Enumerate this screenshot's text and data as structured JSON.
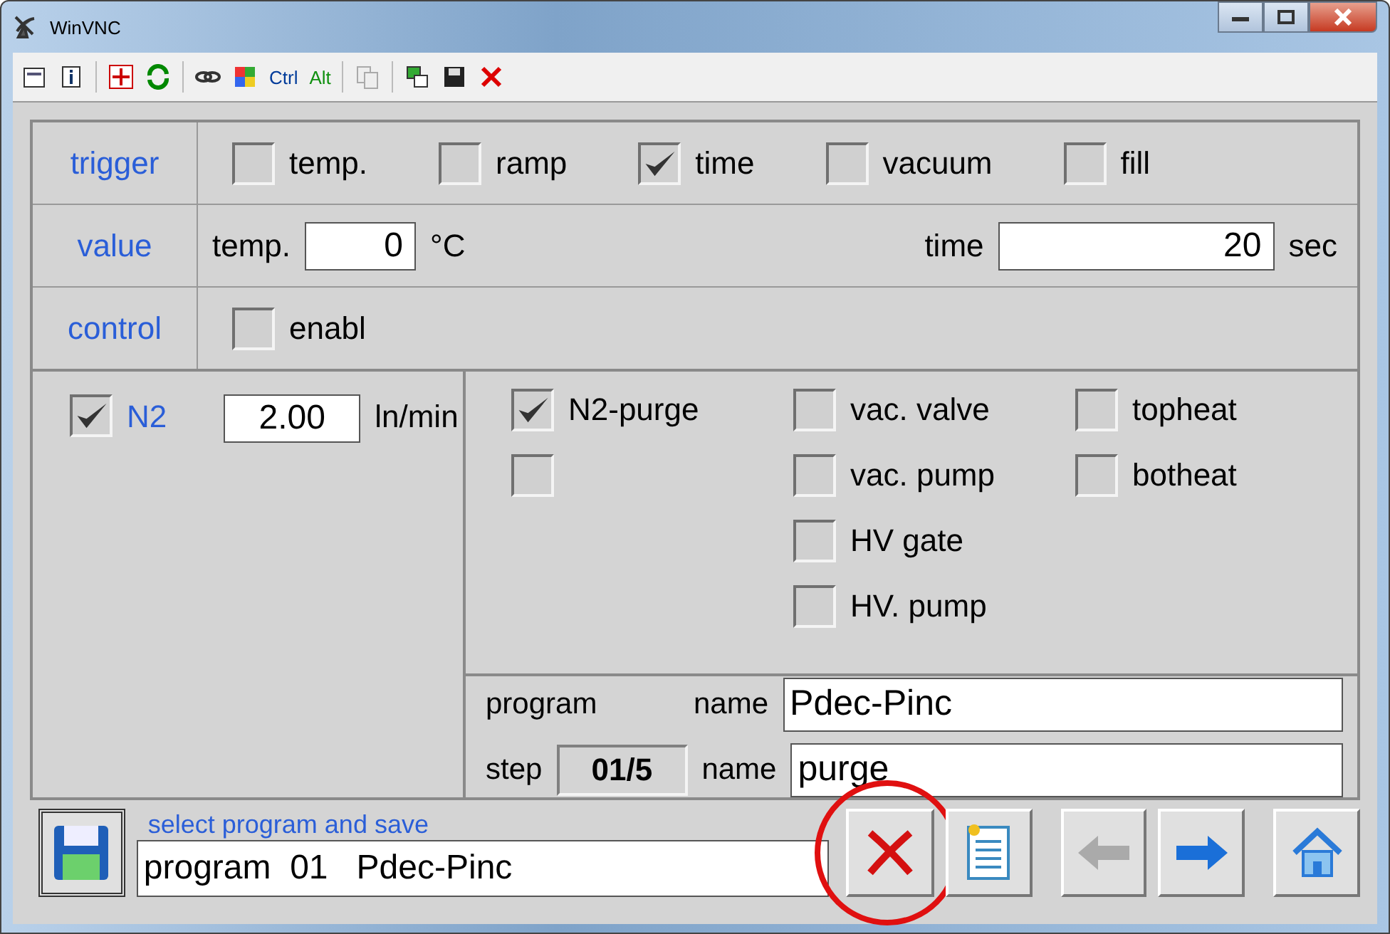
{
  "window": {
    "title": "WinVNC"
  },
  "toolbar": {
    "keys": [
      "Ctrl",
      "Alt"
    ]
  },
  "trigger": {
    "label": "trigger",
    "options": [
      {
        "label": "temp.",
        "checked": false
      },
      {
        "label": "ramp",
        "checked": false
      },
      {
        "label": "time",
        "checked": true
      },
      {
        "label": "vacuum",
        "checked": false
      },
      {
        "label": "fill",
        "checked": false
      }
    ]
  },
  "value": {
    "label": "value",
    "fields": [
      {
        "label": "temp.",
        "value": "0",
        "unit": "°C"
      },
      {
        "label": "time",
        "value": "20",
        "unit": "sec"
      }
    ]
  },
  "control": {
    "label": "control",
    "options": [
      {
        "label": "enabl",
        "checked": false
      }
    ]
  },
  "gas": {
    "label": "N2",
    "checked": true,
    "value": "2.00",
    "unit": "ln/min"
  },
  "outputs": [
    [
      {
        "label": "N2-purge",
        "checked": true
      },
      {
        "checked": false
      }
    ],
    [
      {
        "label": "vac. valve",
        "checked": false
      },
      {
        "label": "vac. pump",
        "checked": false
      },
      {
        "label": "HV gate",
        "checked": false
      },
      {
        "label": "HV. pump",
        "checked": false
      }
    ],
    [
      {
        "label": "topheat",
        "checked": false
      },
      {
        "label": "botheat",
        "checked": false
      }
    ]
  ],
  "program": {
    "label": "program",
    "name_label": "name",
    "name": "Pdec-Pinc",
    "step_label": "step",
    "step": "01/5",
    "step_name_label": "name",
    "step_name": "purge"
  },
  "footer": {
    "hint": "select program and save",
    "selection": "program  01   Pdec-Pinc",
    "delete_highlighted": true
  }
}
